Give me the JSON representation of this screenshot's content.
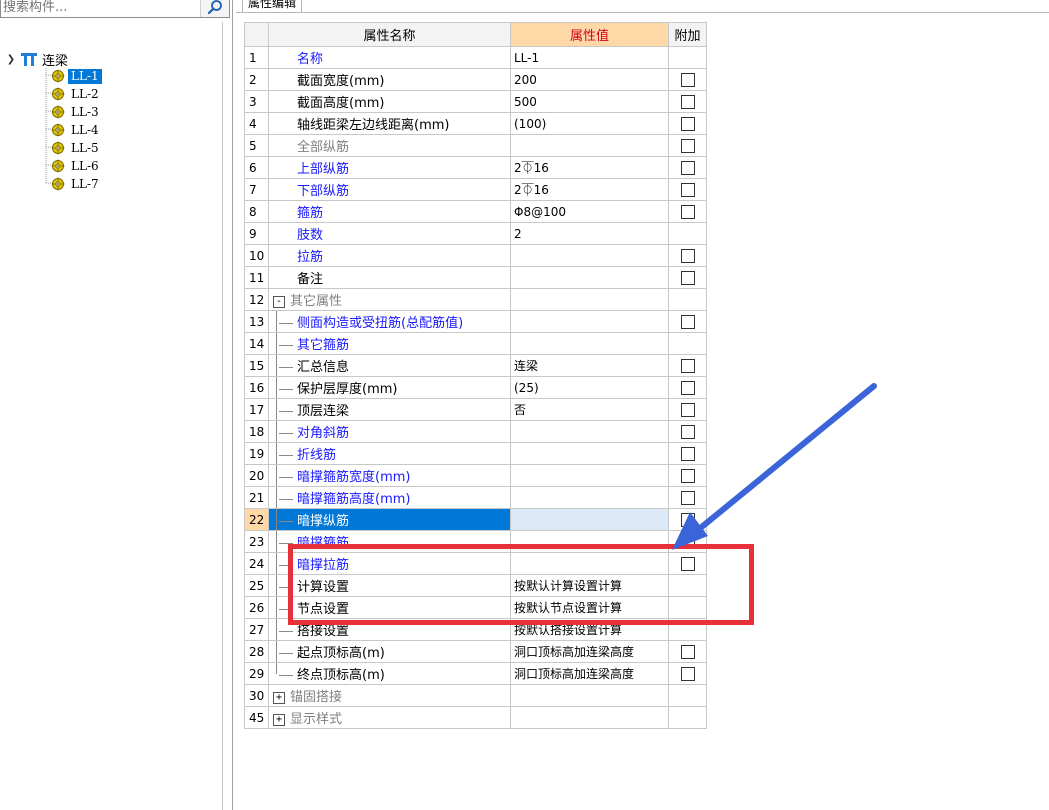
{
  "search": {
    "placeholder": "搜索构件..."
  },
  "tree": {
    "root_label": "连梁",
    "items": [
      {
        "label": "LL-1",
        "selected": true
      },
      {
        "label": "LL-2",
        "selected": false
      },
      {
        "label": "LL-3",
        "selected": false
      },
      {
        "label": "LL-4",
        "selected": false
      },
      {
        "label": "LL-5",
        "selected": false
      },
      {
        "label": "LL-6",
        "selected": false
      },
      {
        "label": "LL-7",
        "selected": false
      }
    ]
  },
  "tab": {
    "label": "属性编辑"
  },
  "table": {
    "headers": {
      "name": "属性名称",
      "value": "属性值",
      "extra": "附加"
    },
    "rows": [
      {
        "num": "1",
        "name": "名称",
        "value": "LL-1",
        "color": "blue",
        "checkbox": false,
        "indent": 0
      },
      {
        "num": "2",
        "name": "截面宽度(mm)",
        "value": "200",
        "color": "black",
        "checkbox": true,
        "indent": 0
      },
      {
        "num": "3",
        "name": "截面高度(mm)",
        "value": "500",
        "color": "black",
        "checkbox": true,
        "indent": 0
      },
      {
        "num": "4",
        "name": "轴线距梁左边线距离(mm)",
        "value": "(100)",
        "color": "black",
        "checkbox": true,
        "indent": 0
      },
      {
        "num": "5",
        "name": "全部纵筋",
        "value": "",
        "color": "gray",
        "checkbox": true,
        "indent": 0
      },
      {
        "num": "6",
        "name": "上部纵筋",
        "value": "2⏁16",
        "color": "blue",
        "checkbox": true,
        "indent": 0
      },
      {
        "num": "7",
        "name": "下部纵筋",
        "value": "2⏁16",
        "color": "blue",
        "checkbox": true,
        "indent": 0
      },
      {
        "num": "8",
        "name": "箍筋",
        "value": "Φ8@100",
        "color": "blue",
        "checkbox": true,
        "indent": 0
      },
      {
        "num": "9",
        "name": "肢数",
        "value": "2",
        "color": "blue",
        "checkbox": false,
        "indent": 0
      },
      {
        "num": "10",
        "name": "拉筋",
        "value": "",
        "color": "blue",
        "checkbox": true,
        "indent": 0
      },
      {
        "num": "11",
        "name": "备注",
        "value": "",
        "color": "black",
        "checkbox": true,
        "indent": 0
      },
      {
        "num": "12",
        "name": "其它属性",
        "value": "",
        "color": "gray",
        "checkbox": false,
        "group": "-"
      },
      {
        "num": "13",
        "name": "侧面构造或受扭筋(总配筋值)",
        "value": "",
        "color": "blue",
        "checkbox": true,
        "indent": 1
      },
      {
        "num": "14",
        "name": "其它箍筋",
        "value": "",
        "color": "blue",
        "checkbox": false,
        "indent": 1
      },
      {
        "num": "15",
        "name": "汇总信息",
        "value": "连梁",
        "color": "black",
        "checkbox": true,
        "indent": 1
      },
      {
        "num": "16",
        "name": "保护层厚度(mm)",
        "value": "(25)",
        "color": "black",
        "checkbox": true,
        "indent": 1
      },
      {
        "num": "17",
        "name": "顶层连梁",
        "value": "否",
        "color": "black",
        "checkbox": true,
        "indent": 1
      },
      {
        "num": "18",
        "name": "对角斜筋",
        "value": "",
        "color": "blue",
        "checkbox": true,
        "indent": 1
      },
      {
        "num": "19",
        "name": "折线筋",
        "value": "",
        "color": "blue",
        "checkbox": true,
        "indent": 1
      },
      {
        "num": "20",
        "name": "暗撑箍筋宽度(mm)",
        "value": "",
        "color": "blue",
        "checkbox": true,
        "indent": 1
      },
      {
        "num": "21",
        "name": "暗撑箍筋高度(mm)",
        "value": "",
        "color": "blue",
        "checkbox": true,
        "indent": 1
      },
      {
        "num": "22",
        "name": "暗撑纵筋",
        "value": "",
        "color": "white",
        "checkbox": true,
        "indent": 1,
        "selected": true
      },
      {
        "num": "23",
        "name": "暗撑箍筋",
        "value": "",
        "color": "blue",
        "checkbox": true,
        "indent": 1
      },
      {
        "num": "24",
        "name": "暗撑拉筋",
        "value": "",
        "color": "blue",
        "checkbox": true,
        "indent": 1
      },
      {
        "num": "25",
        "name": "计算设置",
        "value": "按默认计算设置计算",
        "color": "black",
        "checkbox": false,
        "indent": 1
      },
      {
        "num": "26",
        "name": "节点设置",
        "value": "按默认节点设置计算",
        "color": "black",
        "checkbox": false,
        "indent": 1
      },
      {
        "num": "27",
        "name": "搭接设置",
        "value": "按默认搭接设置计算",
        "color": "black",
        "checkbox": false,
        "indent": 1
      },
      {
        "num": "28",
        "name": "起点顶标高(m)",
        "value": "洞口顶标高加连梁高度",
        "color": "black",
        "checkbox": true,
        "indent": 1
      },
      {
        "num": "29",
        "name": "终点顶标高(m)",
        "value": "洞口顶标高加连梁高度",
        "color": "black",
        "checkbox": true,
        "indent": 1,
        "last": true
      },
      {
        "num": "30",
        "name": "锚固搭接",
        "value": "",
        "color": "gray",
        "checkbox": false,
        "group": "+"
      },
      {
        "num": "45",
        "name": "显示样式",
        "value": "",
        "color": "gray",
        "checkbox": false,
        "group": "+"
      }
    ]
  },
  "colors": {
    "selection": "#0078d7",
    "annotation": "#e8303a",
    "arrow": "#3a64d8",
    "header_value_bg": "#ffd8a8"
  },
  "icons": {
    "search": "search-icon",
    "group": "beam-group-icon",
    "item": "gear-icon"
  }
}
